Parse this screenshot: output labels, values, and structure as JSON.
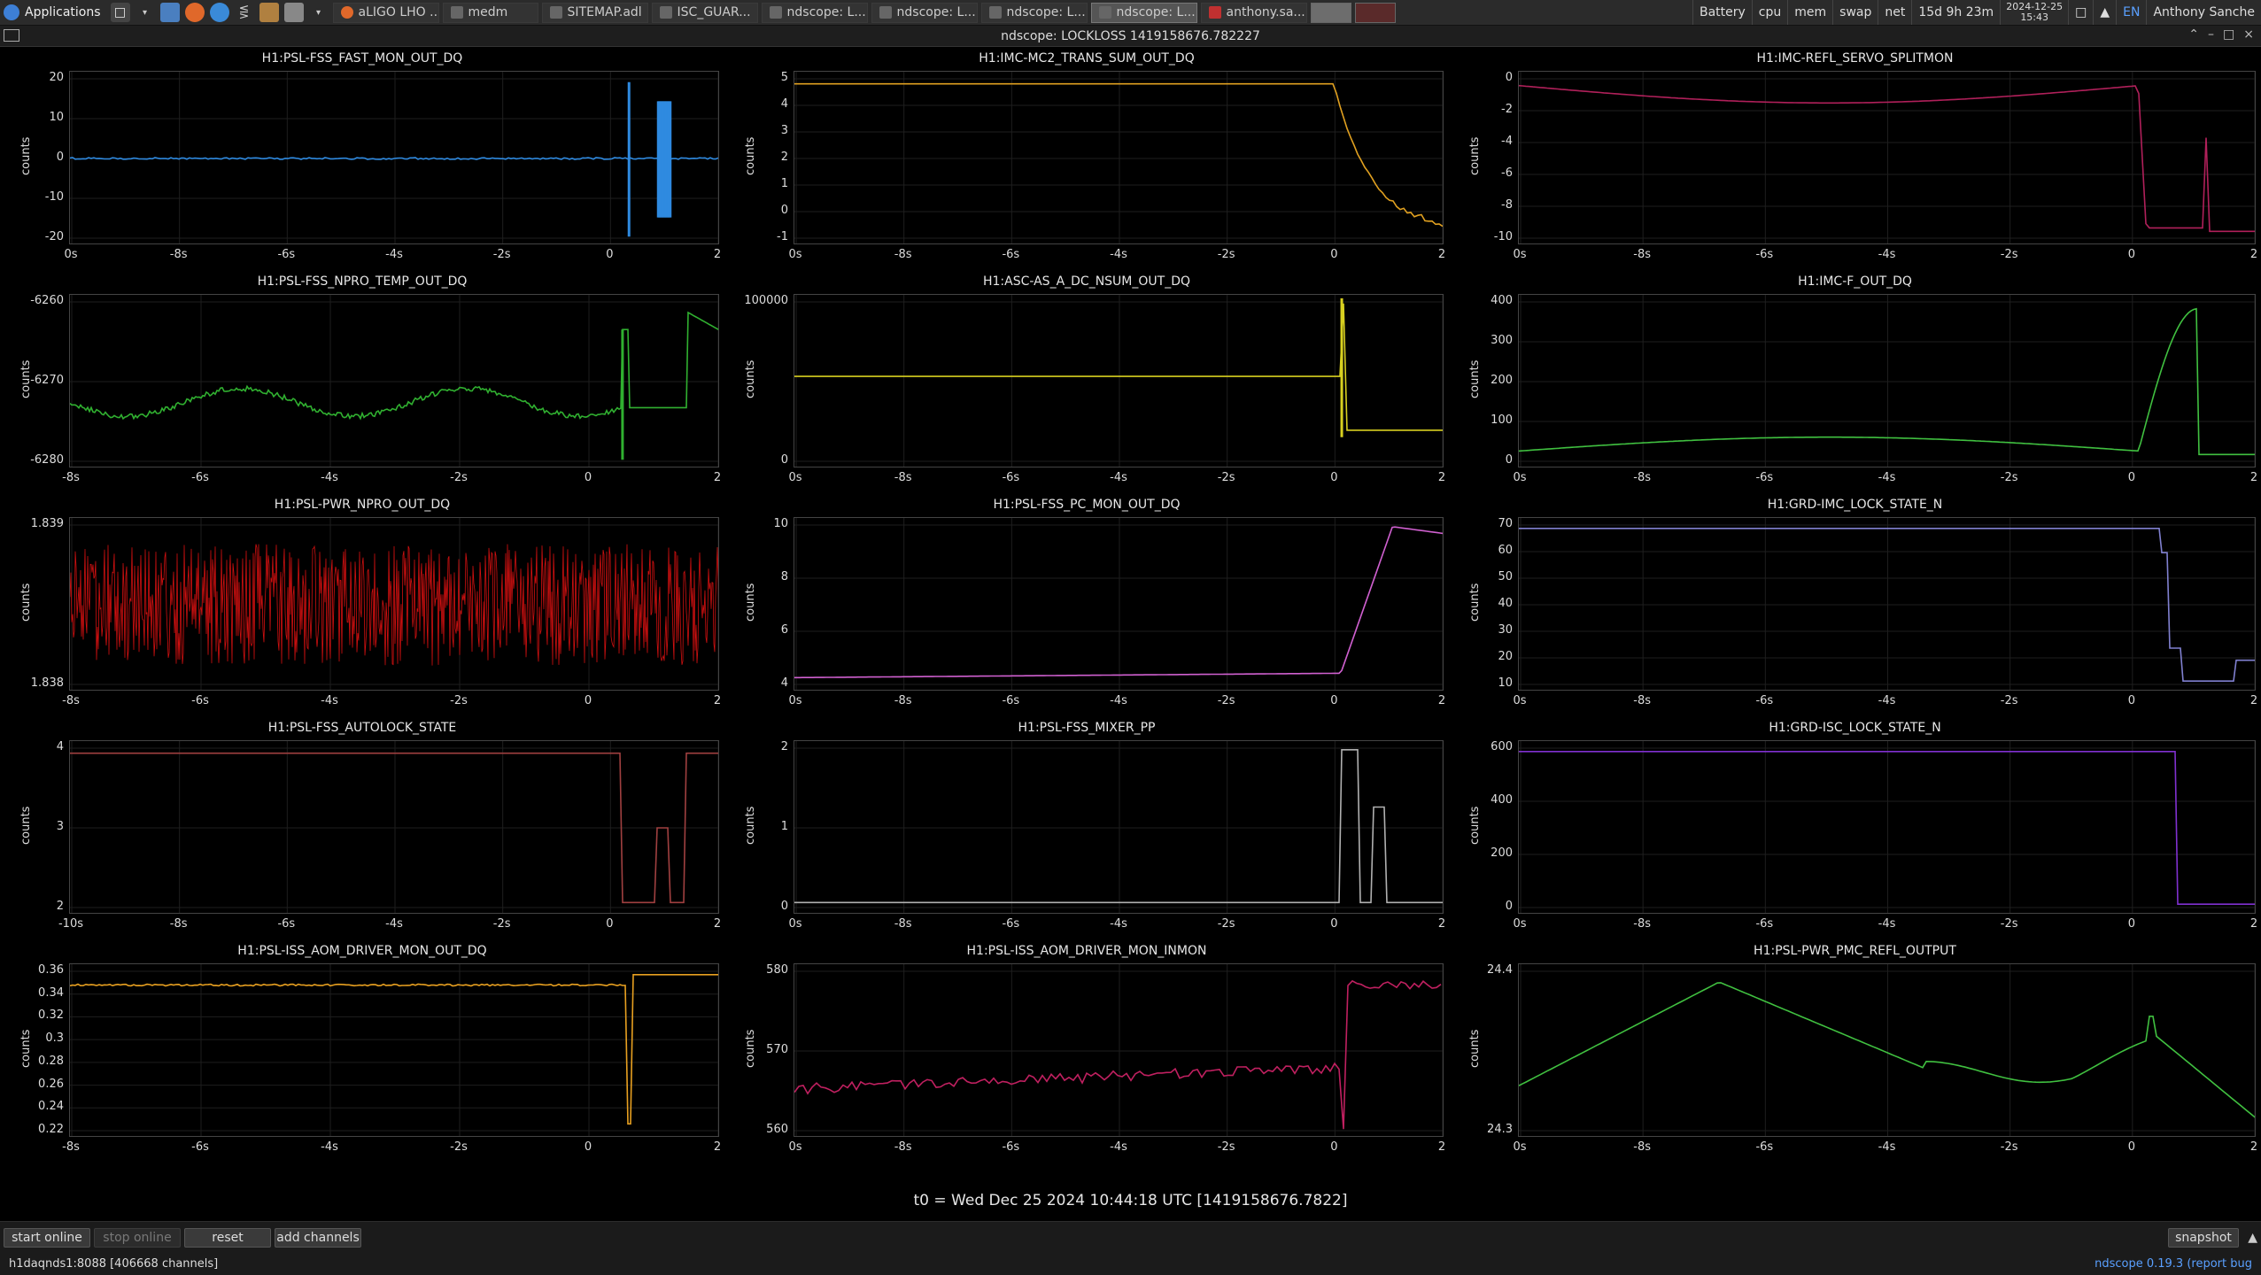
{
  "taskbar": {
    "apps_label": "Applications",
    "tasks": [
      {
        "label": "aLIGO LHO ...",
        "icon": "firefox-icon"
      },
      {
        "label": "medm",
        "icon": "window-icon"
      },
      {
        "label": "SITEMAP.adl",
        "icon": "window-icon"
      },
      {
        "label": "ISC_GUAR...",
        "icon": "window-icon"
      },
      {
        "label": "ndscope: L...",
        "icon": "window-icon"
      },
      {
        "label": "ndscope: L...",
        "icon": "window-icon"
      },
      {
        "label": "ndscope: L...",
        "icon": "window-icon"
      },
      {
        "label": "ndscope: L...",
        "icon": "window-icon"
      },
      {
        "label": "anthony.sa...",
        "icon": "app-icon"
      }
    ],
    "indicators": [
      "Battery",
      "cpu",
      "mem",
      "swap",
      "net"
    ],
    "uptime": "15d 9h 23m",
    "date": "2024-12-25",
    "time": "15:43",
    "lang": "EN",
    "user": "Anthony Sanche"
  },
  "window": {
    "title": "ndscope: LOCKLOSS 1419158676.782227"
  },
  "t0_label": "t0 = Wed Dec 25 2024 10:44:18 UTC [1419158676.7822]",
  "buttons": {
    "start_online": "start online",
    "stop_online": "stop online",
    "reset": "reset",
    "add_channels": "add channels",
    "snapshot": "snapshot"
  },
  "status": {
    "server": "h1daqnds1:8088  [406668 channels]",
    "version": "ndscope 0.19.3 (report bug"
  },
  "panels": [
    {
      "title": "H1:PSL-FSS_FAST_MON_OUT_DQ",
      "ylabel": "counts",
      "color": "#2f8ae0",
      "yticks": [
        "20",
        "10",
        "0",
        "-10",
        "-20"
      ],
      "xticks": [
        "0s",
        "-8s",
        "-6s",
        "-4s",
        "-2s",
        "0",
        "2"
      ]
    },
    {
      "title": "H1:IMC-MC2_TRANS_SUM_OUT_DQ",
      "ylabel": "counts",
      "color": "#e0a020",
      "yticks": [
        "5",
        "4",
        "3",
        "2",
        "1",
        "0",
        "-1"
      ],
      "xticks": [
        "0s",
        "-8s",
        "-6s",
        "-4s",
        "-2s",
        "0",
        "2"
      ]
    },
    {
      "title": "H1:IMC-REFL_SERVO_SPLITMON",
      "ylabel": "counts",
      "color": "#b0205a",
      "yticks": [
        "0",
        "-2",
        "-4",
        "-6",
        "-8",
        "-10"
      ],
      "xticks": [
        "0s",
        "-8s",
        "-6s",
        "-4s",
        "-2s",
        "0",
        "2"
      ]
    },
    {
      "title": "H1:PSL-FSS_NPRO_TEMP_OUT_DQ",
      "ylabel": "counts",
      "color": "#30b030",
      "yticks": [
        "-6260",
        "-6270",
        "-6280"
      ],
      "xticks": [
        "-8s",
        "-6s",
        "-4s",
        "-2s",
        "0",
        "2"
      ]
    },
    {
      "title": "H1:ASC-AS_A_DC_NSUM_OUT_DQ",
      "ylabel": "counts",
      "color": "#d8d020",
      "yticks": [
        "100000",
        "0"
      ],
      "xticks": [
        "0s",
        "-8s",
        "-6s",
        "-4s",
        "-2s",
        "0",
        "2"
      ]
    },
    {
      "title": "H1:IMC-F_OUT_DQ",
      "ylabel": "counts",
      "color": "#40c040",
      "yticks": [
        "400",
        "300",
        "200",
        "100",
        "0"
      ],
      "xticks": [
        "0s",
        "-8s",
        "-6s",
        "-4s",
        "-2s",
        "0",
        "2"
      ]
    },
    {
      "title": "H1:PSL-PWR_NPRO_OUT_DQ",
      "ylabel": "counts",
      "color": "#d01010",
      "yticks": [
        "1.839",
        "1.838"
      ],
      "xticks": [
        "-8s",
        "-6s",
        "-4s",
        "-2s",
        "0",
        "2"
      ]
    },
    {
      "title": "H1:PSL-FSS_PC_MON_OUT_DQ",
      "ylabel": "counts",
      "color": "#d060d0",
      "yticks": [
        "10",
        "8",
        "6",
        "4"
      ],
      "xticks": [
        "0s",
        "-8s",
        "-6s",
        "-4s",
        "-2s",
        "0",
        "2"
      ]
    },
    {
      "title": "H1:GRD-IMC_LOCK_STATE_N",
      "ylabel": "counts",
      "color": "#8080d0",
      "yticks": [
        "70",
        "60",
        "50",
        "40",
        "30",
        "20",
        "10"
      ],
      "xticks": [
        "0s",
        "-8s",
        "-6s",
        "-4s",
        "-2s",
        "0",
        "2"
      ]
    },
    {
      "title": "H1:PSL-FSS_AUTOLOCK_STATE",
      "ylabel": "counts",
      "color": "#a04040",
      "yticks": [
        "4",
        "3",
        "2"
      ],
      "xticks": [
        "-10s",
        "-8s",
        "-6s",
        "-4s",
        "-2s",
        "0",
        "2"
      ]
    },
    {
      "title": "H1:PSL-FSS_MIXER_PP",
      "ylabel": "counts",
      "color": "#b0b0b0",
      "yticks": [
        "2",
        "1",
        "0"
      ],
      "xticks": [
        "0s",
        "-8s",
        "-6s",
        "-4s",
        "-2s",
        "0",
        "2"
      ]
    },
    {
      "title": "H1:GRD-ISC_LOCK_STATE_N",
      "ylabel": "counts",
      "color": "#8030d0",
      "yticks": [
        "600",
        "400",
        "200",
        "0"
      ],
      "xticks": [
        "0s",
        "-8s",
        "-6s",
        "-4s",
        "-2s",
        "0",
        "2"
      ]
    },
    {
      "title": "H1:PSL-ISS_AOM_DRIVER_MON_OUT_DQ",
      "ylabel": "counts",
      "color": "#e8a020",
      "yticks": [
        "0.36",
        "0.34",
        "0.32",
        "0.3",
        "0.28",
        "0.26",
        "0.24",
        "0.22"
      ],
      "xticks": [
        "-8s",
        "-6s",
        "-4s",
        "-2s",
        "0",
        "2"
      ]
    },
    {
      "title": "H1:PSL-ISS_AOM_DRIVER_MON_INMON",
      "ylabel": "counts",
      "color": "#c02060",
      "yticks": [
        "580",
        "570",
        "560"
      ],
      "xticks": [
        "0s",
        "-8s",
        "-6s",
        "-4s",
        "-2s",
        "0",
        "2"
      ]
    },
    {
      "title": "H1:PSL-PWR_PMC_REFL_OUTPUT",
      "ylabel": "counts",
      "color": "#40c040",
      "yticks": [
        "24.4",
        "24.3"
      ],
      "xticks": [
        "0s",
        "-8s",
        "-6s",
        "-4s",
        "-2s",
        "0",
        "2"
      ]
    }
  ]
}
